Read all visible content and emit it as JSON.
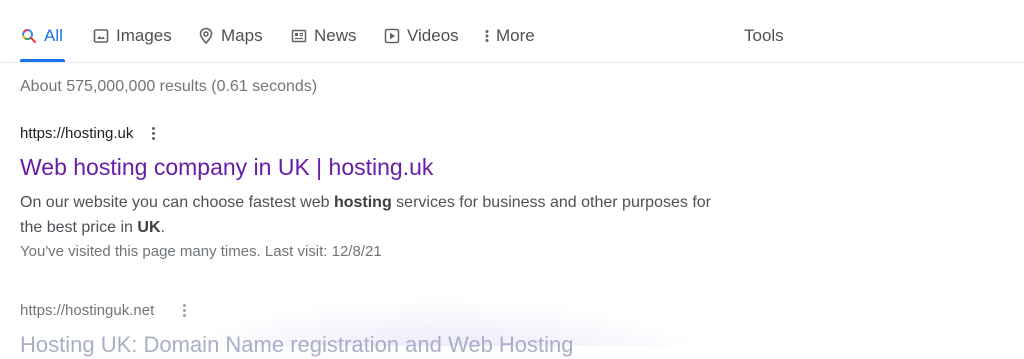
{
  "tabs": [
    {
      "label": "All",
      "icon": "search-icon"
    },
    {
      "label": "Images",
      "icon": "image-icon"
    },
    {
      "label": "Maps",
      "icon": "map-pin-icon"
    },
    {
      "label": "News",
      "icon": "news-icon"
    },
    {
      "label": "Videos",
      "icon": "video-icon"
    },
    {
      "label": "More",
      "icon": "more-vert-icon"
    }
  ],
  "tools_label": "Tools",
  "stats": "About 575,000,000 results (0.61 seconds)",
  "results": [
    {
      "url": "https://hosting.uk",
      "title": "Web hosting company in UK | hosting.uk",
      "snippet_parts": [
        "On our website you can choose fastest web ",
        "hosting",
        " services for business and other purposes for the best price in ",
        "UK",
        "."
      ],
      "visited": "You've visited this page many times. Last visit: 12/8/21"
    },
    {
      "url": "https://hostinguk.net",
      "title": "Hosting UK: Domain Name registration and Web Hosting"
    }
  ],
  "colors": {
    "accent": "#1a73e8",
    "visited_link": "#681da8",
    "text": "#4d5156"
  }
}
